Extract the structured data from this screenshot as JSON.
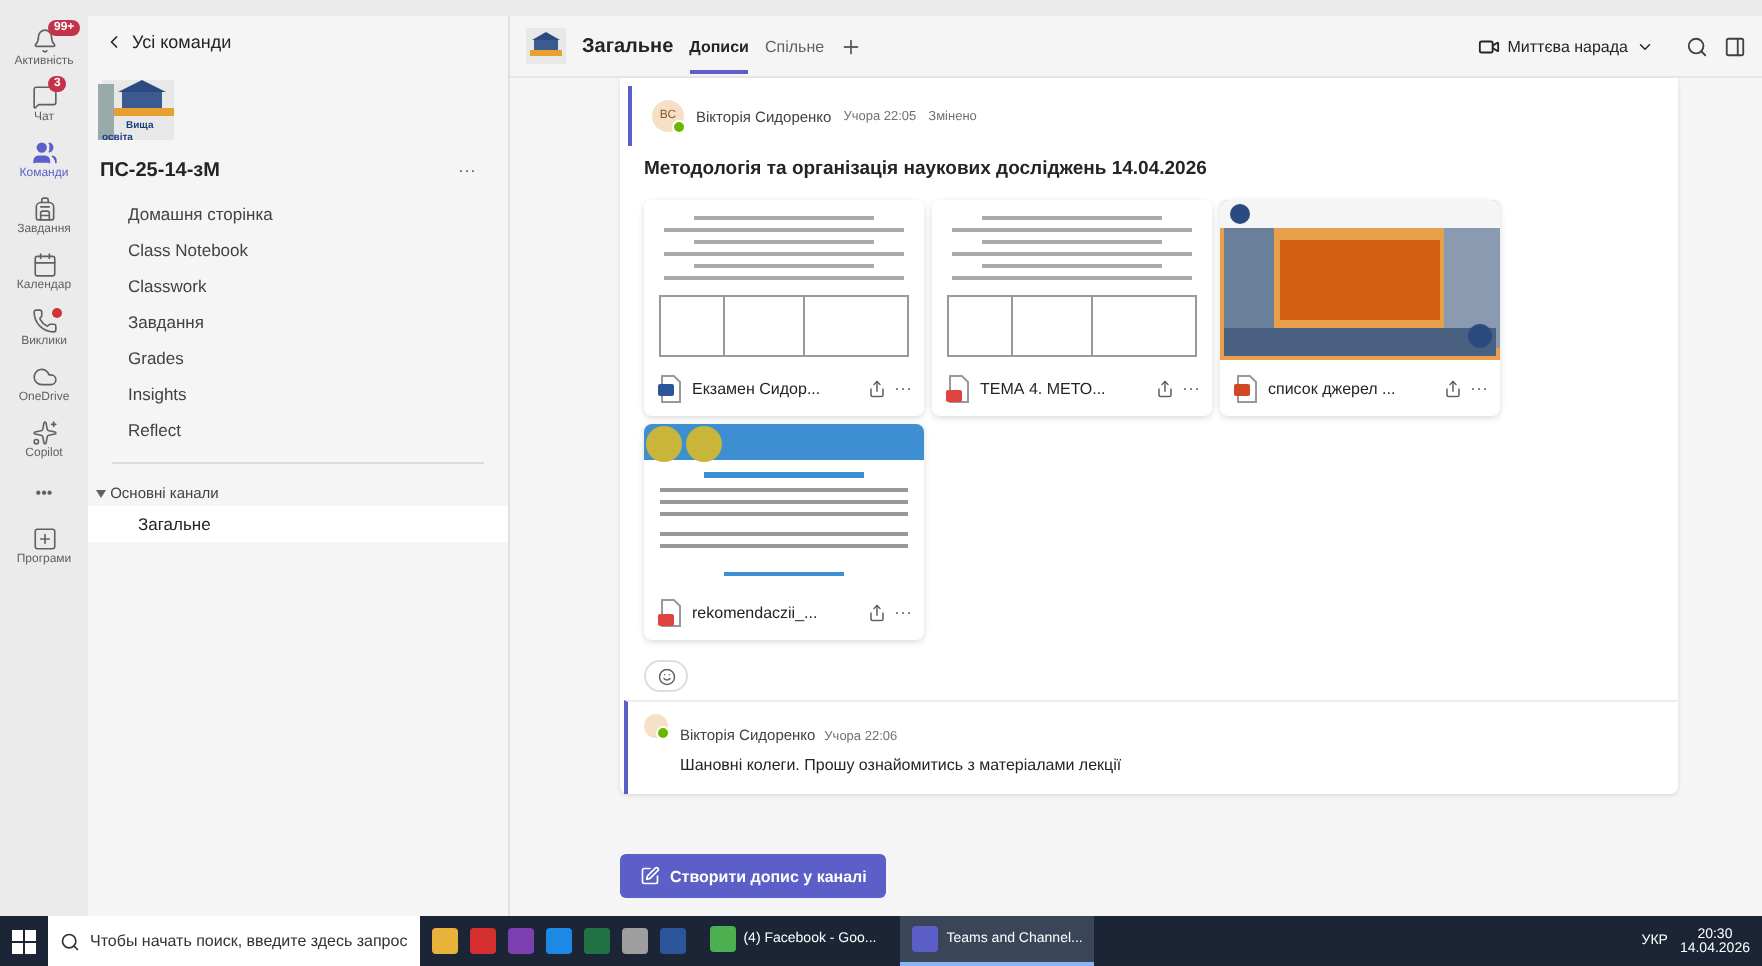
{
  "rail": [
    {
      "label": "Активність",
      "badge": "99+",
      "dot": false,
      "selected": false
    },
    {
      "label": "Чат",
      "badge": "3",
      "dot": false,
      "selected": false
    },
    {
      "label": "Команди",
      "dot": false,
      "selected": true
    },
    {
      "label": "Завдання",
      "dot": false,
      "selected": false
    },
    {
      "label": "Календар",
      "dot": false,
      "selected": false
    },
    {
      "label": "Виклики",
      "dot": true,
      "selected": false
    },
    {
      "label": "OneDrive",
      "dot": false,
      "selected": false
    },
    {
      "label": "Copilot",
      "dot": false,
      "selected": false
    },
    {
      "label": "Програми",
      "dot": false,
      "selected": false
    }
  ],
  "rail_more": "•••",
  "sidebar": {
    "back": "Усі команди",
    "logo_text": "Вища освіта",
    "team": "ПС-25-14-зМ",
    "more": "···",
    "items": [
      {
        "label": "Домашня сторінка"
      },
      {
        "label": "Class Notebook"
      },
      {
        "label": "Classwork"
      },
      {
        "label": "Завдання"
      },
      {
        "label": "Grades"
      },
      {
        "label": "Insights"
      },
      {
        "label": "Reflect"
      }
    ],
    "section": "Основні канали",
    "channels": [
      {
        "label": "Загальне",
        "selected": true
      }
    ]
  },
  "header": {
    "channel": "Загальне",
    "tabs": [
      {
        "label": "Дописи",
        "selected": true
      },
      {
        "label": "Спільне",
        "selected": false
      }
    ],
    "meet": "Миттєва нарада"
  },
  "post": {
    "initials": "ВС",
    "author": "Вікторія Сидоренко",
    "time": "Учора 22:05",
    "edited": "Змінено",
    "title": "Методологія та організація наукових досліджень 14.04.2026",
    "files": [
      {
        "name": "Екзамен Сидор...",
        "kind": "word"
      },
      {
        "name": "ТЕМА 4. МЕТО...",
        "kind": "pdf"
      },
      {
        "name": "список джерел ...",
        "kind": "ppt"
      },
      {
        "name": "rekomendaczii_...",
        "kind": "pdf"
      }
    ],
    "reply": {
      "author": "Вікторія Сидоренко",
      "time": "Учора 22:06",
      "text": "Шановні колеги. Прошу ознайомитись з матеріалами лекції"
    }
  },
  "new_post": "Створити допис у каналі",
  "taskbar": {
    "search": "Чтобы начать поиск, введите здесь запрос",
    "windows": [
      {
        "label": "(4) Facebook - Goo...",
        "selected": false
      },
      {
        "label": "Teams and Channel...",
        "selected": true
      }
    ],
    "lang": "УКР",
    "time": "20:30",
    "date": "14.04.2026"
  }
}
